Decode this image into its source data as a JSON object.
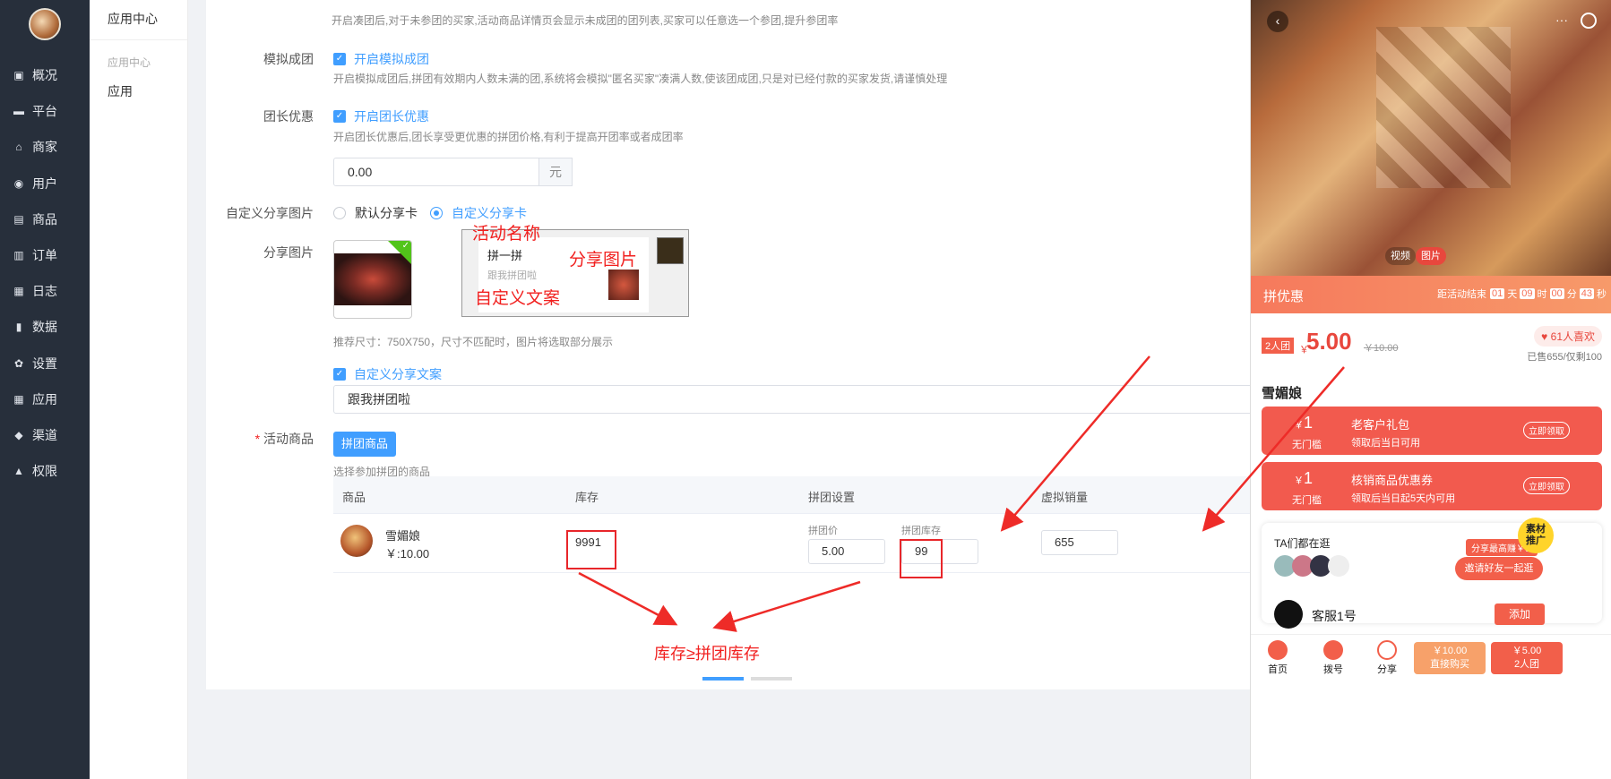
{
  "nav": {
    "items": [
      {
        "label": "概况",
        "icon": "dashboard-icon"
      },
      {
        "label": "平台",
        "icon": "monitor-icon"
      },
      {
        "label": "商家",
        "icon": "store-icon"
      },
      {
        "label": "用户",
        "icon": "user-icon"
      },
      {
        "label": "商品",
        "icon": "goods-icon"
      },
      {
        "label": "订单",
        "icon": "order-icon"
      },
      {
        "label": "日志",
        "icon": "log-icon"
      },
      {
        "label": "数据",
        "icon": "chart-icon"
      },
      {
        "label": "设置",
        "icon": "gear-icon"
      },
      {
        "label": "应用",
        "icon": "apps-icon"
      },
      {
        "label": "渠道",
        "icon": "cube-icon"
      },
      {
        "label": "权限",
        "icon": "lock-icon"
      }
    ]
  },
  "subnav": {
    "title": "应用中心",
    "group": "应用中心",
    "link": "应用"
  },
  "form": {
    "top_hint": "开启凑团后,对于未参团的买家,活动商品详情页会显示未成团的团列表,买家可以任意选一个参团,提升参团率",
    "mock": {
      "label": "模拟成团",
      "check": "开启模拟成团",
      "hint": "开启模拟成团后,拼团有效期内人数未满的团,系统将会模拟\"匿名买家\"凑满人数,使该团成团,只是对已经付款的买家发货,请谨慎处理"
    },
    "leader": {
      "label": "团长优惠",
      "check": "开启团长优惠",
      "hint": "开启团长优惠后,团长享受更优惠的拼团价格,有利于提高开团率或者成团率",
      "value": "0.00",
      "unit": "元"
    },
    "share_card": {
      "label": "自定义分享图片",
      "opt_default": "默认分享卡",
      "opt_custom": "自定义分享卡"
    },
    "share_img": {
      "label": "分享图片",
      "hint": "推荐尺寸：750X750，尺寸不匹配时，图片将选取部分展示"
    },
    "preview": {
      "title": "拼一拼",
      "desc": "跟我拼团啦"
    },
    "annotations": {
      "name": "活动名称",
      "image": "分享图片",
      "text": "自定义文案",
      "rule": "库存≥拼团库存"
    },
    "share_text": {
      "check": "自定义分享文案",
      "value": "跟我拼团啦"
    },
    "goods": {
      "label": "活动商品",
      "required": "*",
      "button": "拼团商品",
      "hint": "选择参加拼团的商品",
      "columns": [
        "商品",
        "库存",
        "拼团设置",
        "虚拟销量"
      ],
      "row": {
        "name": "雪媚娘",
        "price": "￥:10.00",
        "stock": "9991",
        "group_price_label": "拼团价",
        "group_price": "5.00",
        "group_stock_label": "拼团库存",
        "group_stock": "99",
        "virtual_sales": "655"
      }
    }
  },
  "phone": {
    "media_video": "视频",
    "media_image": "图片",
    "banner_title": "拼优惠",
    "countdown_label": "距活动结束",
    "cd": {
      "d": "01",
      "d_unit": "天",
      "h": "09",
      "h_unit": "时",
      "m": "00",
      "m_unit": "分",
      "s": "43",
      "s_unit": "秒"
    },
    "group_tag": "2人团",
    "currency": "￥",
    "price": "5.00",
    "orig_price": "￥10.00",
    "likes": "61人喜欢",
    "sold": "已售655/仅剩100",
    "product": "雪媚娘",
    "coupons": [
      {
        "amount": "1",
        "cur": "￥",
        "cond": "无门槛",
        "title": "老客户礼包",
        "sub": "领取后当日可用",
        "btn": "立即领取"
      },
      {
        "amount": "1",
        "cur": "￥",
        "cond": "无门槛",
        "title": "核销商品优惠券",
        "sub": "领取后当日起5天内可用",
        "btn": "立即领取"
      }
    ],
    "ta_title": "TA们都在逛",
    "share_tip": "分享最高赚￥0.",
    "invite": "邀请好友一起逛",
    "promo": "素材推广",
    "service": "客服1号",
    "add": "添加",
    "bottom": {
      "home": "首页",
      "call": "拨号",
      "share": "分享",
      "buy_price": "￥10.00",
      "buy_label": "直接购买",
      "group_price": "￥5.00",
      "group_label": "2人团"
    }
  }
}
